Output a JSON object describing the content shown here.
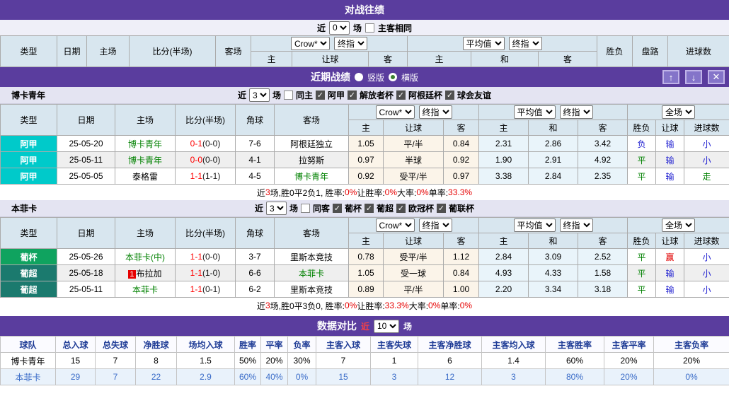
{
  "icons": {
    "up": "↑",
    "down": "↓",
    "close": "✕"
  },
  "colors": {
    "purple": "#5A3D9E",
    "score_red": "#FF0000",
    "team_green": "#008100",
    "win_red": "#E00000",
    "lose_blue": "#2121D1",
    "draw_green": "#008100"
  },
  "h2h": {
    "title": "对战往绩",
    "near_label": "近",
    "matches": "0",
    "unit_label": "场",
    "same_label": "主客相同",
    "dd": {
      "odds": "Crow*",
      "odds_final": "终指",
      "avg": "平均值",
      "avg_final": "终指"
    },
    "cols": {
      "type": "类型",
      "date": "日期",
      "home": "主场",
      "score": "比分(半场)",
      "away": "客场",
      "h": "主",
      "handicap": "让球",
      "a": "客",
      "avg_h": "主",
      "avg_d": "和",
      "avg_a": "客",
      "result": "胜负",
      "trend": "盘路",
      "goals": "进球数"
    }
  },
  "recent": {
    "title": "近期战绩",
    "vertical": "竖版",
    "horizontal": "横版"
  },
  "mid_cols": {
    "type": "类型",
    "date": "日期",
    "home": "主场",
    "score": "比分(半场)",
    "corner": "角球",
    "away": "客场",
    "h": "主",
    "handicap": "让球",
    "a": "客",
    "avg_h": "主",
    "avg_d": "和",
    "avg_a": "客",
    "result": "胜负",
    "hcap_result": "让球",
    "goals": "进球数"
  },
  "mid_dd": {
    "odds": "Crow*",
    "odds_final": "终指",
    "avg": "平均值",
    "avg_final": "终指",
    "scope": "全场"
  },
  "teams": [
    {
      "name": "博卡青年",
      "near_label": "近",
      "matches": "3",
      "unit_label": "场",
      "same_label": "同主",
      "leagues": [
        "阿甲",
        "解放者杯",
        "阿根廷杯",
        "球会友谊"
      ],
      "rows": [
        {
          "lg": "阿甲",
          "lg_bg": "#00CACA",
          "date": "25-05-20",
          "badge": "",
          "home": "博卡青年",
          "home_c": "#008100",
          "ft": "0-1",
          "ht": "(0-0)",
          "cor": "7-6",
          "away": "阿根廷独立",
          "away_c": "#000000",
          "o1": "1.05",
          "hd": "平/半",
          "o2": "0.84",
          "m1": "2.31",
          "m2": "2.86",
          "m3": "3.42",
          "res": "负",
          "res_c": "#2121D1",
          "pan": "输",
          "pan_c": "#2121D1",
          "gl": "小",
          "gl_c": "#2121D1"
        },
        {
          "lg": "阿甲",
          "lg_bg": "#00CACA",
          "date": "25-05-11",
          "badge": "",
          "home": "博卡青年",
          "home_c": "#008100",
          "ft": "0-0",
          "ht": "(0-0)",
          "cor": "4-1",
          "away": "拉努斯",
          "away_c": "#000000",
          "o1": "0.97",
          "hd": "半球",
          "o2": "0.92",
          "m1": "1.90",
          "m2": "2.91",
          "m3": "4.92",
          "res": "平",
          "res_c": "#008100",
          "pan": "输",
          "pan_c": "#2121D1",
          "gl": "小",
          "gl_c": "#2121D1"
        },
        {
          "lg": "阿甲",
          "lg_bg": "#00CACA",
          "date": "25-05-05",
          "badge": "",
          "home": "泰格雷",
          "home_c": "#000000",
          "ft": "1-1",
          "ht": "(1-1)",
          "cor": "4-5",
          "away": "博卡青年",
          "away_c": "#008100",
          "o1": "0.92",
          "hd": "受平/半",
          "o2": "0.97",
          "m1": "3.38",
          "m2": "2.84",
          "m3": "2.35",
          "res": "平",
          "res_c": "#008100",
          "pan": "输",
          "pan_c": "#2121D1",
          "gl": "走",
          "gl_c": "#008100"
        }
      ],
      "summary": {
        "p1": "近",
        "v1": "3",
        "p2": "场,胜0平2负1, 胜率:",
        "v2": "0%",
        "p3": " 让胜率:",
        "v3": "0%",
        "p4": " 大率:",
        "v4": "0%",
        "p5": " 单率:",
        "v5": "33.3%"
      }
    },
    {
      "name": "本菲卡",
      "near_label": "近",
      "matches": "3",
      "unit_label": "场",
      "same_label": "同客",
      "leagues": [
        "葡杯",
        "葡超",
        "欧冠杯",
        "葡联杯"
      ],
      "rows": [
        {
          "lg": "葡杯",
          "lg_bg": "#0FA35F",
          "date": "25-05-26",
          "badge": "",
          "home": "本菲卡(中)",
          "home_c": "#008100",
          "ft": "1-1",
          "ht": "(0-0)",
          "cor": "3-7",
          "away": "里斯本竞技",
          "away_c": "#000000",
          "o1": "0.78",
          "hd": "受平/半",
          "o2": "1.12",
          "m1": "2.84",
          "m2": "3.09",
          "m3": "2.52",
          "res": "平",
          "res_c": "#008100",
          "pan": "赢",
          "pan_c": "#E00000",
          "gl": "小",
          "gl_c": "#2121D1"
        },
        {
          "lg": "葡超",
          "lg_bg": "#1B7A6E",
          "date": "25-05-18",
          "badge": "1",
          "home": "布拉加",
          "home_c": "#000000",
          "ft": "1-1",
          "ht": "(1-0)",
          "cor": "6-6",
          "away": "本菲卡",
          "away_c": "#008100",
          "o1": "1.05",
          "hd": "受一球",
          "o2": "0.84",
          "m1": "4.93",
          "m2": "4.33",
          "m3": "1.58",
          "res": "平",
          "res_c": "#008100",
          "pan": "输",
          "pan_c": "#2121D1",
          "gl": "小",
          "gl_c": "#2121D1"
        },
        {
          "lg": "葡超",
          "lg_bg": "#1B7A6E",
          "date": "25-05-11",
          "badge": "",
          "home": "本菲卡",
          "home_c": "#008100",
          "ft": "1-1",
          "ht": "(0-1)",
          "cor": "6-2",
          "away": "里斯本竞技",
          "away_c": "#000000",
          "o1": "0.89",
          "hd": "平/半",
          "o2": "1.00",
          "m1": "2.20",
          "m2": "3.34",
          "m3": "3.18",
          "res": "平",
          "res_c": "#008100",
          "pan": "输",
          "pan_c": "#2121D1",
          "gl": "小",
          "gl_c": "#2121D1"
        }
      ],
      "summary": {
        "p1": "近",
        "v1": "3",
        "p2": "场,胜0平3负0, 胜率:",
        "v2": "0%",
        "p3": " 让胜率:",
        "v3": "33.3%",
        "p4": " 大率:",
        "v4": "0%",
        "p5": " 单率:",
        "v5": "0%"
      }
    }
  ],
  "compare": {
    "title": "数据对比",
    "near_label": "近",
    "matches": "10",
    "unit_label": "场",
    "headers": [
      "球队",
      "总入球",
      "总失球",
      "净胜球",
      "场均入球",
      "胜率",
      "平率",
      "负率",
      "主客入球",
      "主客失球",
      "主客净胜球",
      "主客均入球",
      "主客胜率",
      "主客平率",
      "主客负率"
    ],
    "rows": [
      {
        "color": "#000000",
        "bg": "#FFFFFF",
        "cells": [
          "博卡青年",
          "15",
          "7",
          "8",
          "1.5",
          "50%",
          "20%",
          "30%",
          "7",
          "1",
          "6",
          "1.4",
          "60%",
          "20%",
          "20%"
        ]
      },
      {
        "color": "#3A6CC8",
        "bg": "#E9F2FB",
        "cells": [
          "本菲卡",
          "29",
          "7",
          "22",
          "2.9",
          "60%",
          "40%",
          "0%",
          "15",
          "3",
          "12",
          "3",
          "80%",
          "20%",
          "0%"
        ]
      }
    ]
  }
}
